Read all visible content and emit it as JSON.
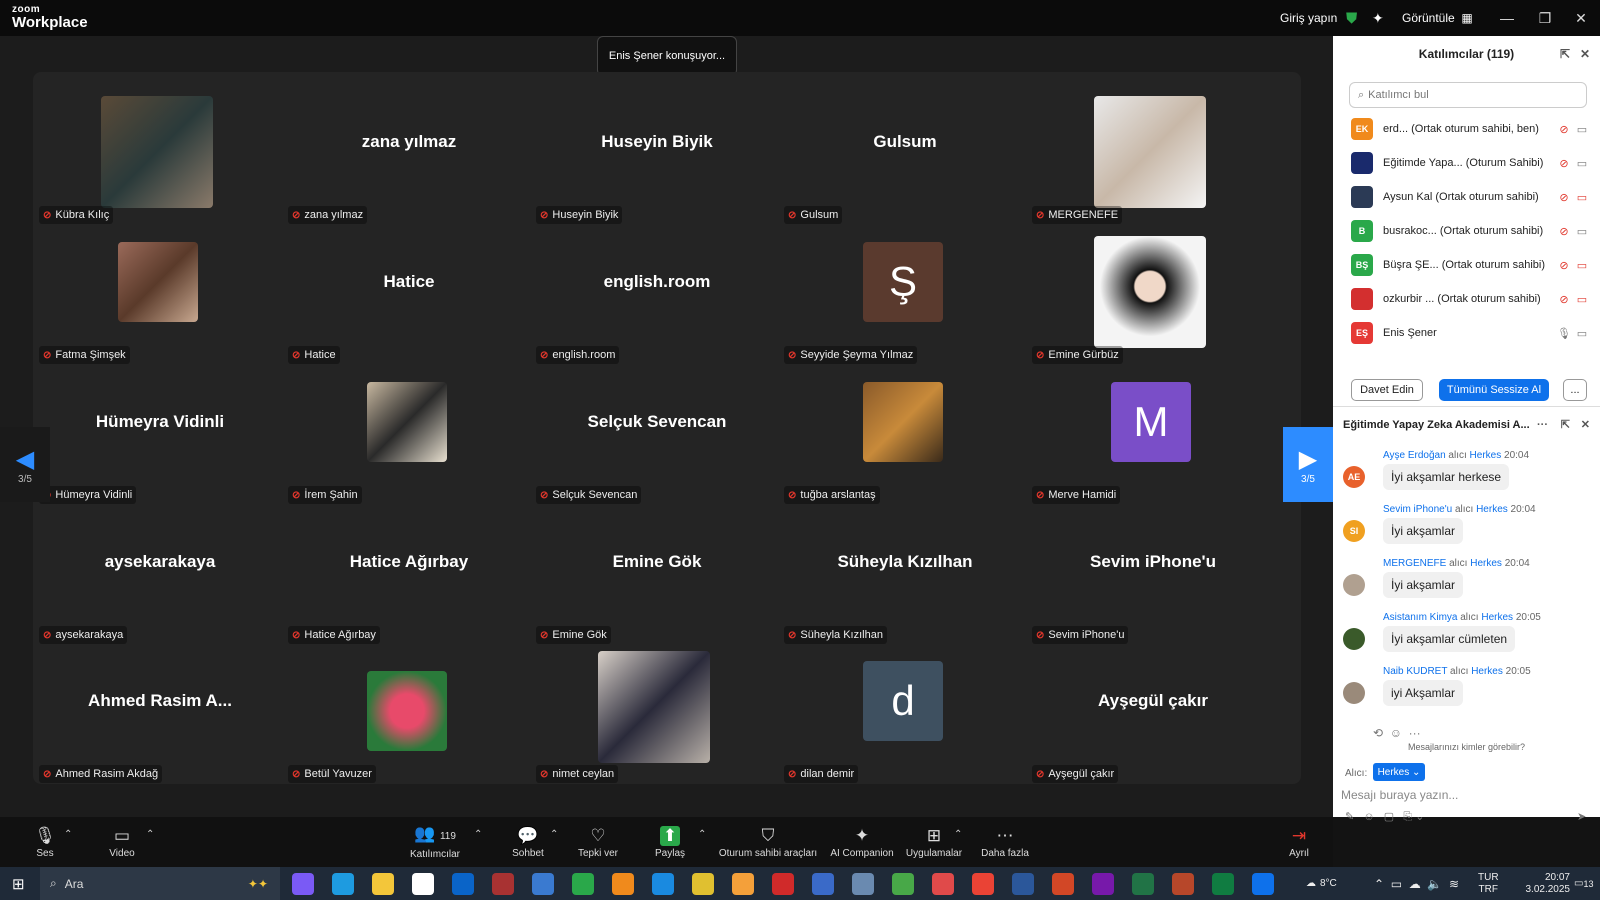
{
  "app": {
    "logo_top": "zoom",
    "logo_bottom": "Workplace",
    "signin": "Giriş yapın",
    "view": "Görüntüle"
  },
  "speaking": "Enis Şener konuşuyor...",
  "pager": {
    "left": "3/5",
    "right": "3/5"
  },
  "tiles": [
    {
      "label": "Kübra Kılıç",
      "center": ""
    },
    {
      "label": "zana yılmaz",
      "center": "zana yılmaz"
    },
    {
      "label": "Huseyin Biyik",
      "center": "Huseyin Biyik"
    },
    {
      "label": "Gulsum",
      "center": "Gulsum"
    },
    {
      "label": "MERGENEFE",
      "center": ""
    },
    {
      "label": "Fatma Şimşek",
      "center": ""
    },
    {
      "label": "Hatice",
      "center": "Hatice"
    },
    {
      "label": "english.room",
      "center": "english.room"
    },
    {
      "label": "Seyyide Şeyma Yılmaz",
      "center": "",
      "letter": "Ş"
    },
    {
      "label": "Emine Gürbüz",
      "center": ""
    },
    {
      "label": "Hümeyra Vidinli",
      "center": "Hümeyra Vidinli"
    },
    {
      "label": "İrem Şahin",
      "center": ""
    },
    {
      "label": "Selçuk Sevencan",
      "center": "Selçuk Sevencan"
    },
    {
      "label": "tuğba arslantaş",
      "center": ""
    },
    {
      "label": "Merve Hamidi",
      "center": "",
      "letter": "M"
    },
    {
      "label": "aysekarakaya",
      "center": "aysekarakaya"
    },
    {
      "label": "Hatice Ağırbay",
      "center": "Hatice Ağırbay"
    },
    {
      "label": "Emine Gök",
      "center": "Emine Gök"
    },
    {
      "label": "Süheyla Kızılhan",
      "center": "Süheyla Kızılhan"
    },
    {
      "label": "Sevim iPhone'u",
      "center": "Sevim iPhone'u"
    },
    {
      "label": "Ahmed Rasim Akdağ",
      "center": "Ahmed  Rasim  A..."
    },
    {
      "label": "Betül Yavuzer",
      "center": ""
    },
    {
      "label": "nimet ceylan",
      "center": ""
    },
    {
      "label": "dilan demir",
      "center": "",
      "letter": "d"
    },
    {
      "label": "Ayşegül çakır",
      "center": "Ayşegül çakır"
    }
  ],
  "participants": {
    "title": "Katılımcılar (119)",
    "search_placeholder": "Katılımcı bul",
    "rows": [
      {
        "initials": "EK",
        "color": "#f08a1c",
        "name": "erd...  (Ortak oturum sahibi, ben)"
      },
      {
        "initials": "",
        "color": "#1a2a6c",
        "name": "Eğitimde Yapa...  (Oturum Sahibi)"
      },
      {
        "initials": "",
        "color": "#2b3a55",
        "name": "Aysun Kal (Ortak oturum sahibi)"
      },
      {
        "initials": "B",
        "color": "#2aa84a",
        "name": "busrakoc...  (Ortak oturum sahibi)"
      },
      {
        "initials": "BŞ",
        "color": "#2aa84a",
        "name": "Büşra ŞE...  (Ortak oturum sahibi)"
      },
      {
        "initials": "",
        "color": "#d32f2f",
        "name": "ozkurbir ...  (Ortak oturum sahibi)"
      },
      {
        "initials": "EŞ",
        "color": "#e53935",
        "name": "Enis Şener"
      }
    ],
    "invite": "Davet Edin",
    "mute_all": "Tümünü Sessize Al",
    "more": "..."
  },
  "chat": {
    "title": "Eğitimde Yapay Zeka Akademisi A...",
    "messages": [
      {
        "sender": "Ayşe Erdoğan",
        "to_word": "alıcı",
        "to": "Herkes",
        "time": "20:04",
        "text": "İyi akşamlar herkese",
        "initials": "AE",
        "color": "#e8612c"
      },
      {
        "sender": "Sevim iPhone'u",
        "to_word": "alıcı",
        "to": "Herkes",
        "time": "20:04",
        "text": "İyi akşamlar",
        "initials": "SI",
        "color": "#f0a020"
      },
      {
        "sender": "MERGENEFE",
        "to_word": "alıcı",
        "to": "Herkes",
        "time": "20:04",
        "text": "İyi akşamlar",
        "initials": "",
        "color": "#b0a090"
      },
      {
        "sender": "Asistanım Kimya",
        "to_word": "alıcı",
        "to": "Herkes",
        "time": "20:05",
        "text": "İyi akşamlar cümleten",
        "initials": "",
        "color": "#3a5a2a"
      },
      {
        "sender": "Naib KUDRET",
        "to_word": "alıcı",
        "to": "Herkes",
        "time": "20:05",
        "text": "iyi Akşamlar",
        "initials": "",
        "color": "#9a8a7a"
      }
    ],
    "who_can_see": "Mesajlarınızı kimler görebilir?",
    "recipient_label": "Alıcı:",
    "recipient": "Herkes",
    "placeholder": "Mesajı buraya yazın..."
  },
  "toolbar": {
    "audio": "Ses",
    "video": "Video",
    "participants": "Katılımcılar",
    "participant_count": "119",
    "chat": "Sohbet",
    "react": "Tepki ver",
    "share": "Paylaş",
    "host_tools": "Oturum sahibi araçları",
    "ai": "AI Companion",
    "apps": "Uygulamalar",
    "more": "Daha fazla",
    "leave": "Ayrıl"
  },
  "taskbar": {
    "search": "Ara",
    "temp": "8°C",
    "lang1": "TUR",
    "lang2": "TRF",
    "time": "20:07",
    "date": "3.02.2025",
    "notif": "13"
  }
}
